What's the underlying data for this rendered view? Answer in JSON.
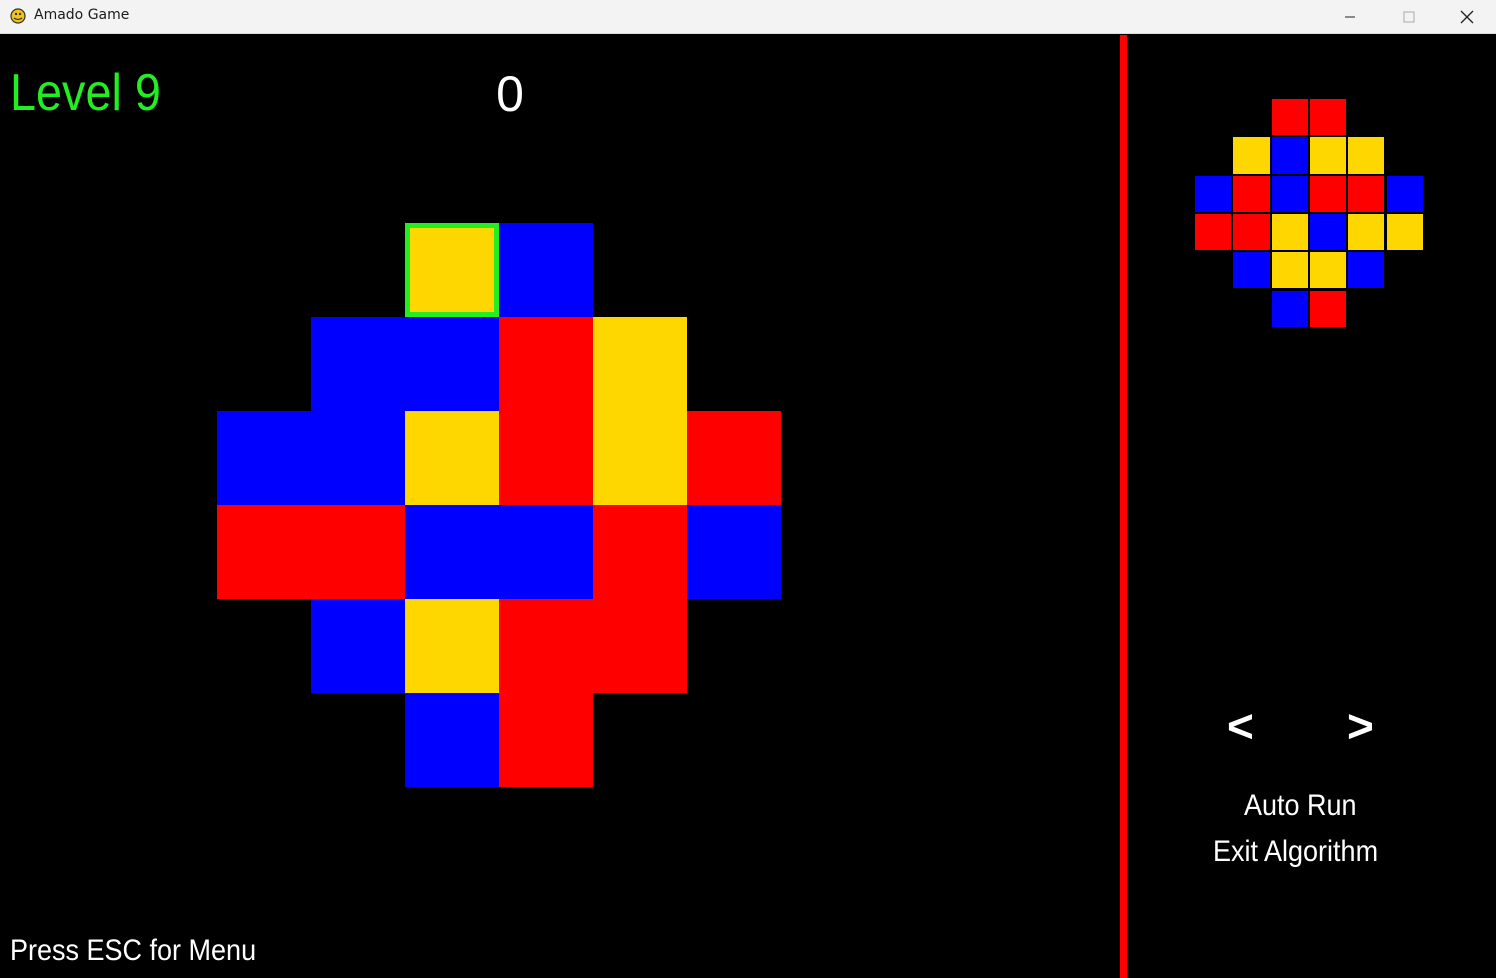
{
  "window": {
    "title": "Amado Game",
    "app_icon": "pygame-snake-icon",
    "controls": [
      "minimize-icon",
      "maximize-icon",
      "close-icon"
    ]
  },
  "hud": {
    "level_label": "Level 9",
    "moves": "0"
  },
  "colors": {
    "R": "#ff0000",
    "B": "#0000ff",
    "Y": "#ffd700",
    "divider": "#ff0000",
    "selection": "#22ee22",
    "level_text": "#22ee22"
  },
  "board": {
    "selected": [
      0,
      2
    ],
    "rows": [
      "..YB..",
      ".BBRY.",
      "BBYRYR",
      "RRBBRB",
      ".BYRR.",
      "..BR.."
    ]
  },
  "target": {
    "rows": [
      "..RR..",
      ".YBYY.",
      "BRBRRB",
      "RRYBYY",
      ".BYYB.",
      "..BR.."
    ]
  },
  "controls_panel": {
    "prev_label": "<",
    "next_label": ">",
    "auto_run_label": "Auto Run",
    "exit_algorithm_label": "Exit Algorithm"
  },
  "footer": {
    "esc_hint": "Press ESC for Menu"
  }
}
